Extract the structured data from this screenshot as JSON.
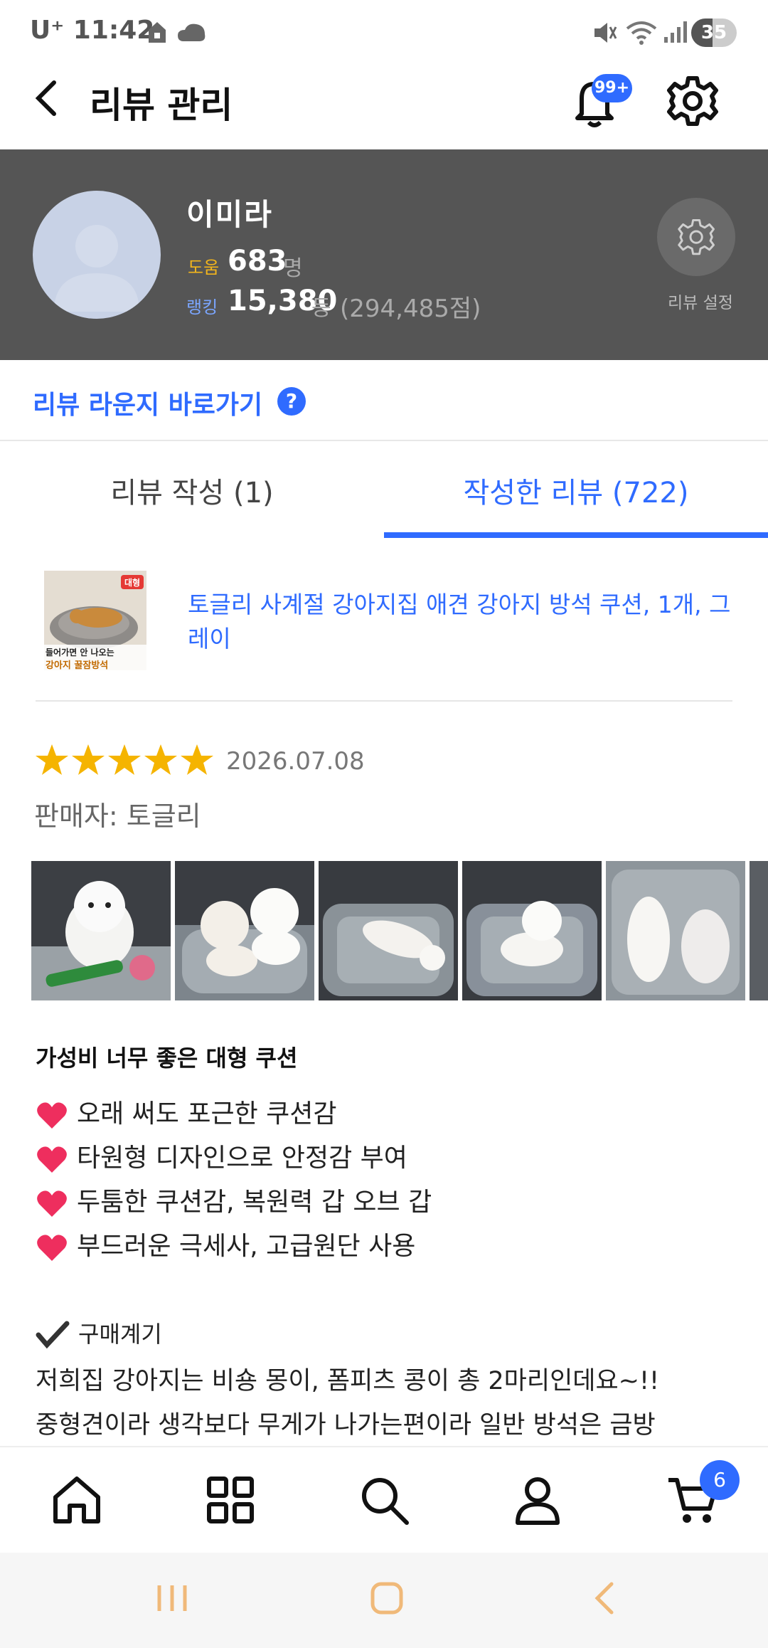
{
  "status_bar": {
    "carrier": "U⁺ 11:42",
    "battery": "35"
  },
  "header": {
    "title": "리뷰 관리",
    "notification_badge": "99+"
  },
  "profile": {
    "name": "이미라",
    "help_label": "도움",
    "help_count": "683",
    "help_unit": "명",
    "rank_label": "랭킹",
    "rank_value": "15,380",
    "rank_unit": "등",
    "rank_points": "(294,485점)",
    "settings_label": "리뷰 설정"
  },
  "lounge_link": {
    "label": "리뷰 라운지 바로가기",
    "help_glyph": "?"
  },
  "tabs": [
    {
      "label": "리뷰 작성 (1)",
      "active": false
    },
    {
      "label": "작성한 리뷰 (722)",
      "active": true
    }
  ],
  "product": {
    "title": "토글리 사계절 강아지집 애견 강아지 방석 쿠션, 1개, 그레이",
    "thumb_badge": "대형",
    "thumb_caption_1": "들어가면 안 나오는",
    "thumb_caption_2": "강아지 꿀잠방석"
  },
  "review": {
    "rating": 5,
    "date": "2026.07.08",
    "seller": "판매자: 토글리",
    "heading": "가성비 너무 좋은 대형 쿠션",
    "bullets": [
      "오래 써도 포근한 쿠션감",
      "타원형 디자인으로 안정감 부여",
      "두툼한 쿠션감, 복원력 갑 오브 갑",
      "부드러운 극세사, 고급원단 사용"
    ],
    "purpose_label": "구매계기",
    "body_lines": [
      "저희집 강아지는 비숑 몽이, 폼피츠 콩이 총 2마리인데요~!!",
      "중형견이라 생각보다 무게가 나가는편이라 일반 방석은 금방"
    ]
  },
  "bottom_nav": {
    "cart_count": "6"
  },
  "colors": {
    "accent": "#2f6bff",
    "profile_bg": "#555555",
    "star": "#f5b400"
  }
}
